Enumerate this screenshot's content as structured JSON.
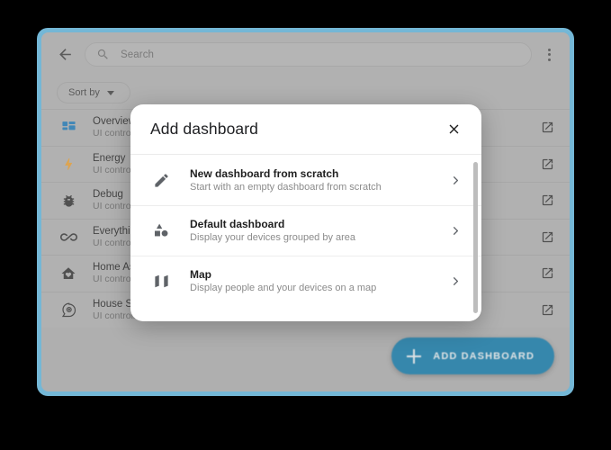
{
  "theme": {
    "frame_border_color": "#74b7d6",
    "app_background": "#b3b3b3",
    "fab_color": "#1d7fac",
    "dialog_background": "#ffffff",
    "accent_blue": "#2a7fba",
    "accent_orange": "#e8a33d"
  },
  "app_bar": {
    "back_icon": "arrow-back-icon",
    "search_icon": "search-icon",
    "search_value": "",
    "search_placeholder": "Search",
    "overflow_icon": "more-vert-icon"
  },
  "filter_bar": {
    "sort_label": "Sort by",
    "sort_caret": "chevron-down-icon"
  },
  "list": {
    "open_icon": "open-in-new-icon",
    "rows": [
      {
        "title": "Overview",
        "subtitle": "UI controlled",
        "icon": "view-dashboard-icon",
        "icon_color": "#2a7fba"
      },
      {
        "title": "Energy",
        "subtitle": "UI controlled",
        "icon": "lightning-bolt-icon",
        "icon_color": "#e8a33d"
      },
      {
        "title": "Debug",
        "subtitle": "UI controlled",
        "icon": "bug-icon",
        "icon_color": "#3c3c3c"
      },
      {
        "title": "Everything",
        "subtitle": "UI controlled",
        "icon": "infinity-icon",
        "icon_color": "#3c3c3c"
      },
      {
        "title": "Home Assistant",
        "subtitle": "UI controlled",
        "icon": "home-heart-icon",
        "icon_color": "#3c3c3c"
      },
      {
        "title": "House Security",
        "subtitle": "UI controlled",
        "icon": "head-cog-icon",
        "icon_color": "#3c3c3c"
      }
    ]
  },
  "fab": {
    "icon": "plus-icon",
    "label": "ADD DASHBOARD"
  },
  "dialog": {
    "title": "Add dashboard",
    "close_icon": "close-icon",
    "scrollbar": "vertical-scrollbar",
    "options": [
      {
        "title": "New dashboard from scratch",
        "subtitle": "Start with an empty dashboard from scratch",
        "icon": "pencil-icon",
        "chevron": "chevron-right-icon"
      },
      {
        "title": "Default dashboard",
        "subtitle": "Display your devices grouped by area",
        "icon": "shapes-icon",
        "chevron": "chevron-right-icon"
      },
      {
        "title": "Map",
        "subtitle": "Display people and your devices on a map",
        "icon": "map-icon",
        "chevron": "chevron-right-icon"
      }
    ]
  }
}
